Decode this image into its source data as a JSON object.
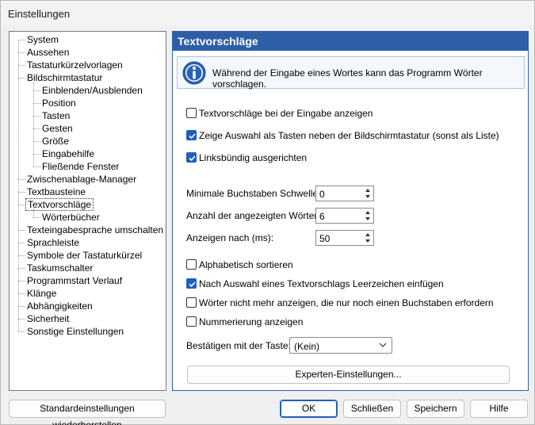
{
  "window": {
    "title": "Einstellungen"
  },
  "tree": {
    "items": [
      {
        "label": "System",
        "level": 0,
        "selected": false
      },
      {
        "label": "Aussehen",
        "level": 0,
        "selected": false
      },
      {
        "label": "Tastaturkürzelvorlagen",
        "level": 0,
        "selected": false
      },
      {
        "label": "Bildschirmtastatur",
        "level": 0,
        "selected": false
      },
      {
        "label": "Einblenden/Ausblenden",
        "level": 1,
        "selected": false
      },
      {
        "label": "Position",
        "level": 1,
        "selected": false
      },
      {
        "label": "Tasten",
        "level": 1,
        "selected": false
      },
      {
        "label": "Gesten",
        "level": 1,
        "selected": false
      },
      {
        "label": "Größe",
        "level": 1,
        "selected": false
      },
      {
        "label": "Eingabehilfe",
        "level": 1,
        "selected": false
      },
      {
        "label": "Fließende Fenster",
        "level": 1,
        "selected": false
      },
      {
        "label": "Zwischenablage-Manager",
        "level": 0,
        "selected": false
      },
      {
        "label": "Textbausteine",
        "level": 0,
        "selected": false
      },
      {
        "label": "Textvorschläge",
        "level": 0,
        "selected": true
      },
      {
        "label": "Wörterbücher",
        "level": 1,
        "selected": false
      },
      {
        "label": "Texteingabesprache umschalten",
        "level": 0,
        "selected": false
      },
      {
        "label": "Sprachleiste",
        "level": 0,
        "selected": false
      },
      {
        "label": "Symbole der Tastaturkürzel",
        "level": 0,
        "selected": false
      },
      {
        "label": "Taskumschalter",
        "level": 0,
        "selected": false
      },
      {
        "label": "Programmstart Verlauf",
        "level": 0,
        "selected": false
      },
      {
        "label": "Klänge",
        "level": 0,
        "selected": false
      },
      {
        "label": "Abhängigkeiten",
        "level": 0,
        "selected": false
      },
      {
        "label": "Sicherheit",
        "level": 0,
        "selected": false
      },
      {
        "label": "Sonstige Einstellungen",
        "level": 0,
        "selected": false
      }
    ]
  },
  "panel": {
    "header": "Textvorschläge",
    "info_icon": "info-icon",
    "info_text": "Während der Eingabe eines Wortes kann das Programm Wörter vorschlagen.",
    "checkboxes_top": [
      {
        "label": "Textvorschläge bei der Eingabe anzeigen",
        "checked": false
      },
      {
        "label": "Zeige Auswahl als Tasten neben der Bildschirmtastatur (sonst als Liste)",
        "checked": true
      },
      {
        "label": "Linksbündig ausgerichten",
        "checked": true
      }
    ],
    "fields": [
      {
        "label": "Minimale Buchstaben Schwelle:",
        "value": "0"
      },
      {
        "label": "Anzahl der angezeigten Wörter:",
        "value": "6"
      },
      {
        "label": "Anzeigen nach (ms):",
        "value": "50"
      }
    ],
    "checkboxes_bottom": [
      {
        "label": "Alphabetisch sortieren",
        "checked": false
      },
      {
        "label": "Nach Auswahl eines Textvorschlags Leerzeichen einfügen",
        "checked": true
      },
      {
        "label": "Wörter nicht mehr anzeigen, die nur noch einen Buchstaben erfordern",
        "checked": false
      },
      {
        "label": "Nummerierung anzeigen",
        "checked": false
      }
    ],
    "confirm_label": "Bestätigen mit der Taste:",
    "confirm_value": "(Kein)",
    "expert_button": "Experten-Einstellungen..."
  },
  "footer": {
    "restore_button": "Standardeinstellungen wiederherstellen",
    "ok_button": "OK",
    "close_button": "Schließen",
    "save_button": "Speichern",
    "help_button": "Hilfe"
  },
  "colors": {
    "header_bg": "#2e5ea7",
    "check_accent": "#1f5fc0"
  }
}
